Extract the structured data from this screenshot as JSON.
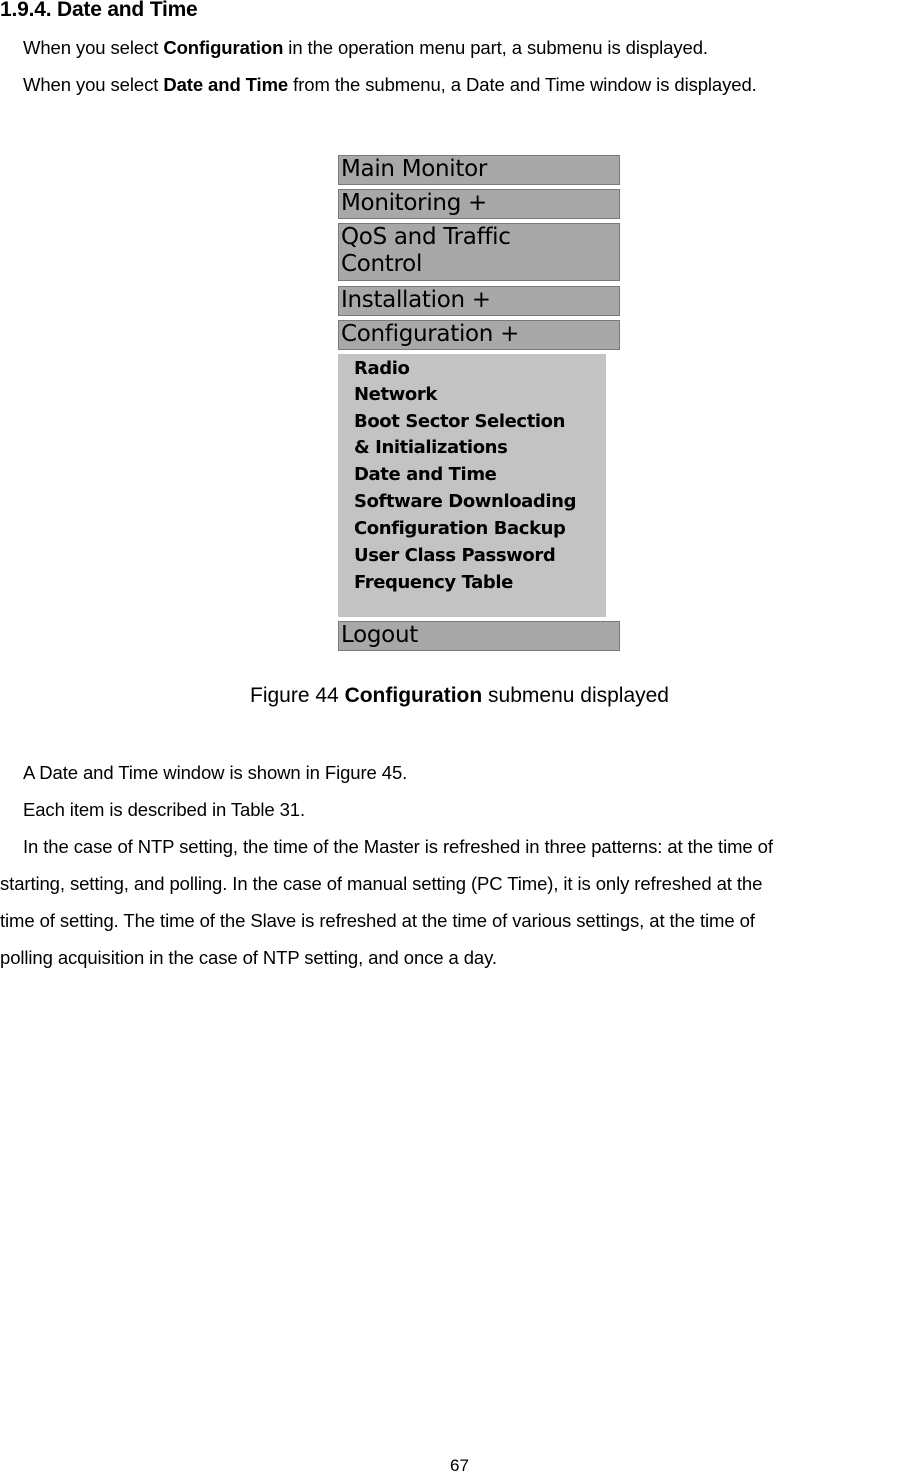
{
  "section": {
    "heading": "1.9.4. Date and Time",
    "intro": [
      {
        "pre": "When you select ",
        "bold": "Configuration",
        "post": " in the operation menu part, a submenu is displayed."
      },
      {
        "pre": "When you select ",
        "bold": "Date and Time",
        "post": " from the submenu, a Date and Time window is displayed."
      }
    ]
  },
  "figure": {
    "menu": {
      "items": [
        {
          "label": "Main Monitor"
        },
        {
          "label": "Monitoring +"
        },
        {
          "label": "QoS and Traffic",
          "label2": "Control"
        },
        {
          "label": "Installation +"
        },
        {
          "label": "Configuration +"
        }
      ],
      "submenu": [
        "Radio",
        "Network",
        "Boot Sector Selection",
        "& Initializations",
        "Date and Time",
        "Software Downloading",
        "Configuration Backup",
        "User Class Password",
        "Frequency Table"
      ],
      "logout": "Logout"
    },
    "caption": {
      "pre": "Figure 44 ",
      "bold": "Configuration",
      "post": " submenu displayed"
    }
  },
  "body": {
    "lines": [
      "A Date and Time window is shown in Figure 45.",
      "Each item is described in Table 31.",
      "In the case of NTP setting, the time of the Master is refreshed in three patterns: at the time of",
      "starting, setting, and polling. In the case of manual setting (PC Time), it is only refreshed at the",
      "time of setting. The time of the Slave is refreshed at the time of various settings, at the time of",
      "polling acquisition in the case of NTP setting, and once a day."
    ]
  },
  "page_number": "67"
}
